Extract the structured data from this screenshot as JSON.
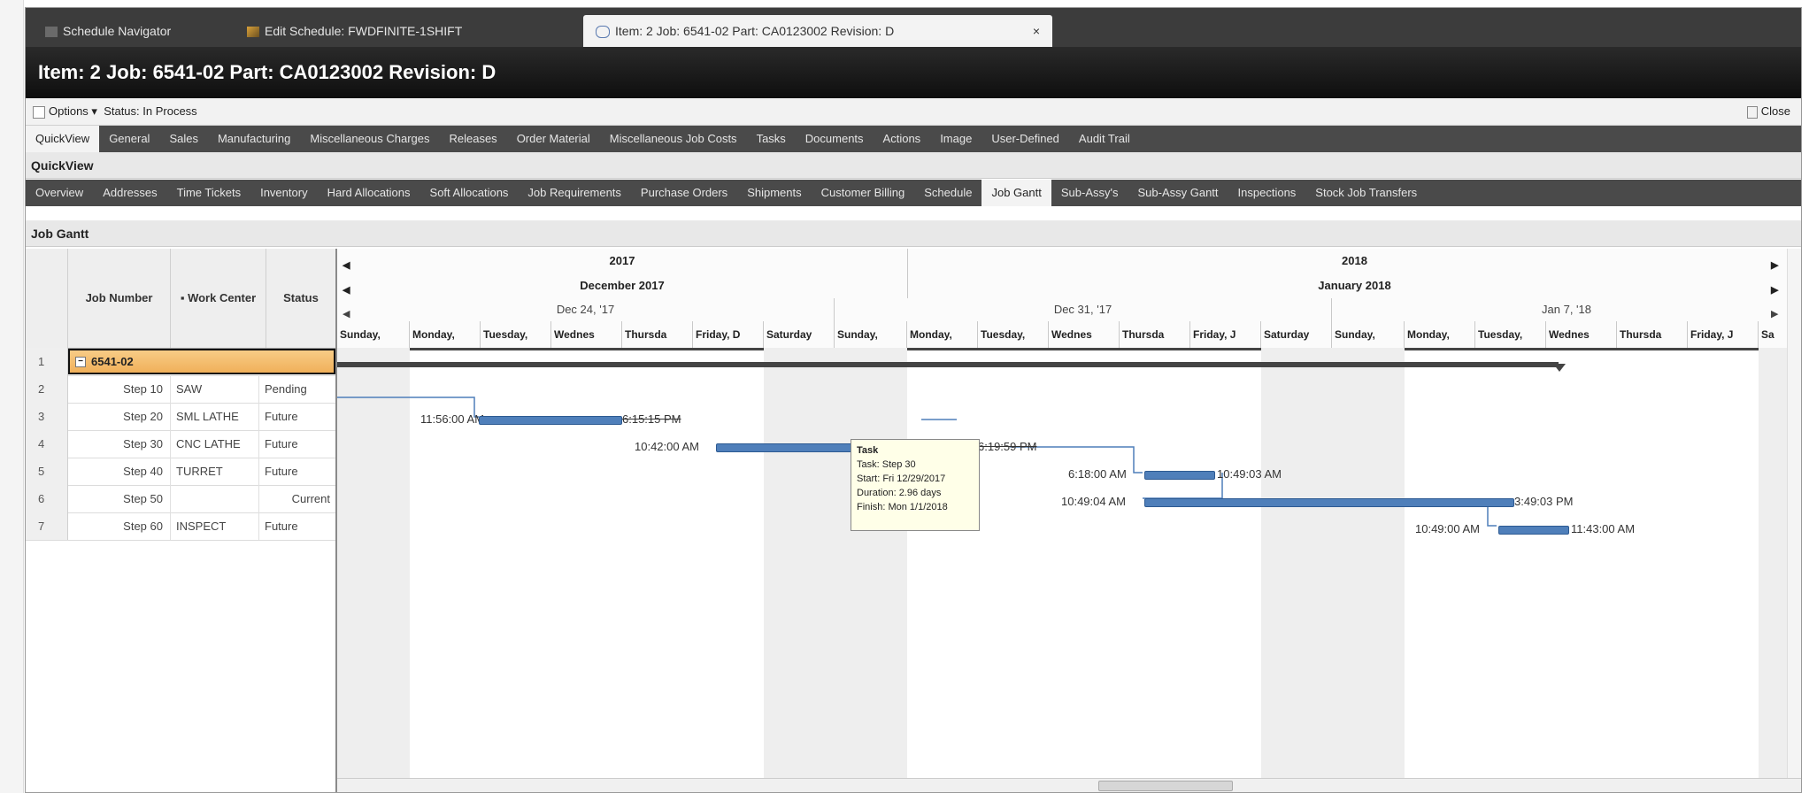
{
  "doc_tabs": [
    {
      "label": "Schedule Navigator"
    },
    {
      "label": "Edit Schedule: FWDFINITE-1SHIFT"
    },
    {
      "label": "Item: 2 Job: 6541-02 Part: CA0123002 Revision: D",
      "close": "×"
    }
  ],
  "title": "Item: 2 Job: 6541-02 Part: CA0123002 Revision: D",
  "options": {
    "label": "Options ▾",
    "status": "Status: In Process",
    "close": "Close"
  },
  "main_tabs": [
    "QuickView",
    "General",
    "Sales",
    "Manufacturing",
    "Miscellaneous Charges",
    "Releases",
    "Order Material",
    "Miscellaneous Job Costs",
    "Tasks",
    "Documents",
    "Actions",
    "Image",
    "User-Defined",
    "Audit Trail"
  ],
  "quickview_label": "QuickView",
  "sub_tabs": [
    "Overview",
    "Addresses",
    "Time Tickets",
    "Inventory",
    "Hard Allocations",
    "Soft Allocations",
    "Job Requirements",
    "Purchase Orders",
    "Shipments",
    "Customer Billing",
    "Schedule",
    "Job Gantt",
    "Sub-Assy's",
    "Sub-Assy Gantt",
    "Inspections",
    "Stock Job Transfers"
  ],
  "section_label": "Job Gantt",
  "grid": {
    "headers": {
      "job": "Job Number",
      "wc": "▪ Work Center",
      "status": "Status"
    },
    "group": {
      "num": "1",
      "label": "6541-02",
      "expander": "−"
    },
    "rows": [
      {
        "num": "2",
        "job": "Step 10",
        "wc": "SAW",
        "status": "Pending"
      },
      {
        "num": "3",
        "job": "Step 20",
        "wc": "SML LATHE",
        "status": "Future"
      },
      {
        "num": "4",
        "job": "Step 30",
        "wc": "CNC LATHE",
        "status": "Future"
      },
      {
        "num": "5",
        "job": "Step 40",
        "wc": "TURRET",
        "status": "Future"
      },
      {
        "num": "6",
        "job": "Step 50",
        "wc": "",
        "status": "Current"
      },
      {
        "num": "7",
        "job": "Step 60",
        "wc": "INSPECT",
        "status": "Future"
      }
    ]
  },
  "gantt": {
    "years": [
      "2017",
      "2018"
    ],
    "months": [
      "December 2017",
      "January 2018"
    ],
    "weeks": [
      "Dec 24, '17",
      "Dec 31, '17",
      "Jan 7, '18"
    ],
    "days": [
      "Sunday,",
      "Monday,",
      "Tuesday,",
      "Wednes",
      "Thursda",
      "Friday, D",
      "Saturday",
      "Sunday,",
      "Monday,",
      "Tuesday,",
      "Wednes",
      "Thursda",
      "Friday, J",
      "Saturday",
      "Sunday,",
      "Monday,",
      "Tuesday,",
      "Wednes",
      "Thursda",
      "Friday, J",
      "Sa"
    ],
    "labels": {
      "step10_start": "11:56:00 AM",
      "step10_end": "6:15:15 PM",
      "step20_start": "10:42:00 AM",
      "step20_end": "6:19:59 PM",
      "step30_start": "6:18:00 AM",
      "step30_end": "10:49:03 AM",
      "step40_start": "10:49:04 AM",
      "step40_end": "3:49:03 PM",
      "step50_start": "10:49:00 AM",
      "step50_end": "11:43:00 AM"
    },
    "tooltip": {
      "title": "Task",
      "task": "Task: Step 30",
      "start": "Start: Fri 12/29/2017",
      "duration": "Duration: 2.96 days",
      "finish": "Finish: Mon 1/1/2018"
    }
  },
  "colors": {
    "bar": "#4f7fba",
    "group_row": "#f0b05a",
    "header_dark": "#4a4a4a"
  }
}
